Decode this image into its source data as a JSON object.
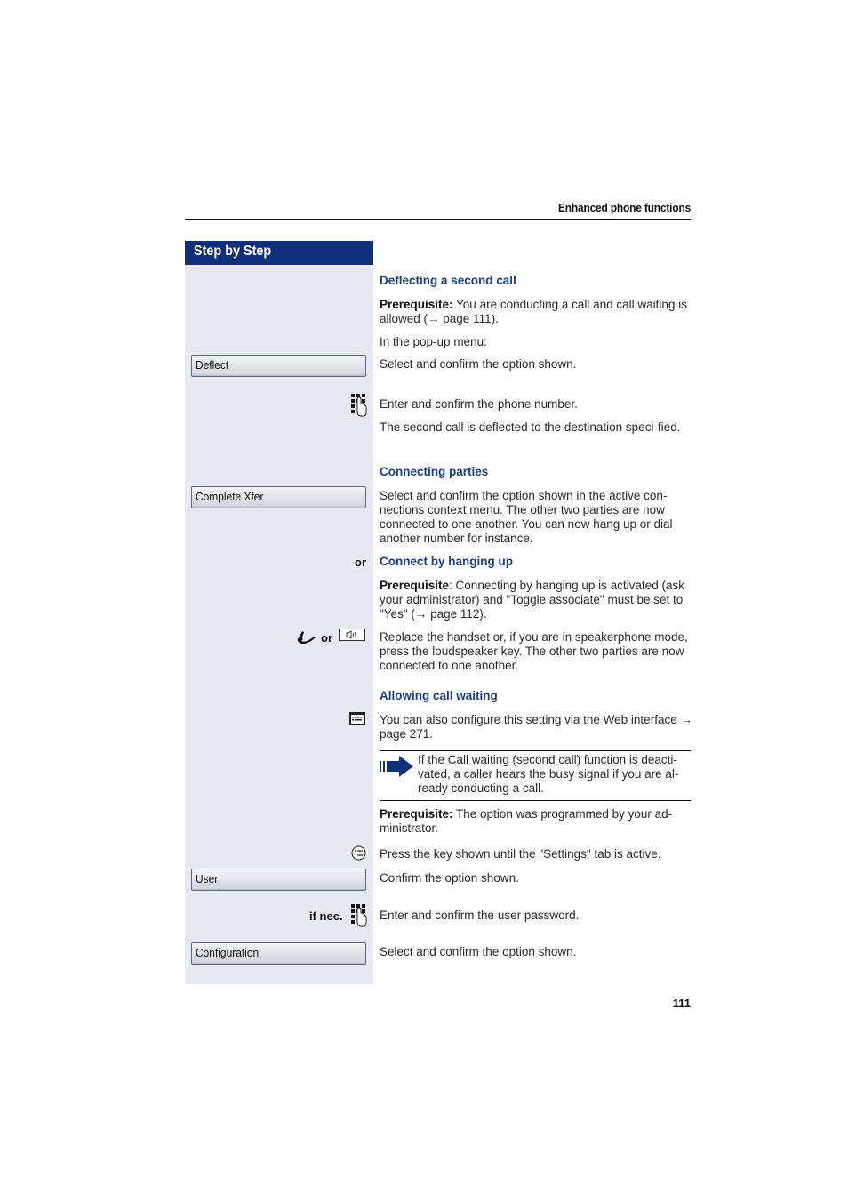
{
  "header": {
    "section_title": "Enhanced phone functions"
  },
  "sidebar": {
    "title": "Step by Step"
  },
  "sections": {
    "deflect": {
      "heading": "Deflecting a second call",
      "prereq_label": "Prerequisite:",
      "prereq_text": " You are conducting a call and call waiting is allowed (→ page 111).",
      "popup_text": "In the pop-up menu:",
      "softkey": "Deflect",
      "softkey_text": "Select and confirm the option shown.",
      "keypad_text": "Enter and confirm the phone number.",
      "result_text": "The second call is deflected to the destination speci-fied."
    },
    "connecting": {
      "heading": "Connecting parties",
      "softkey": "Complete Xfer",
      "softkey_text": "Select and confirm the option shown in the active con-nections context menu. The other two parties are now connected to one another. You can now hang up or dial another number for instance.",
      "or_label": "or"
    },
    "hangup": {
      "heading": "Connect by hanging up",
      "prereq_label": "Prerequisite",
      "prereq_text": ": Connecting by hanging up is activated (ask your administrator) and \"Toggle associate\" must be set to \"Yes\" (→ page 112).",
      "or_label": "or",
      "action_text": "Replace the handset or, if you are in speakerphone mode, press the loudspeaker key. The other two parties are now connected to one another."
    },
    "waiting": {
      "heading": "Allowing call waiting",
      "web_text": "You can also configure this setting via the Web interface → page 271.",
      "note_text": "If the Call waiting (second call) function is deacti-vated, a caller hears the busy signal if you are al-ready conducting a call.",
      "prereq_label": "Prerequisite:",
      "prereq_text": " The option was programmed by your ad-ministrator.",
      "menu_key_text": "Press the key shown until the \"Settings\" tab is active.",
      "softkey_user": "User",
      "user_text": "Confirm the option shown.",
      "if_nec_label": "if nec.",
      "password_text": "Enter and confirm the user password.",
      "softkey_config": "Configuration",
      "config_text": "Select and confirm the option shown."
    }
  },
  "footer": {
    "page_number": "111"
  },
  "colors": {
    "sidebar_header": "#12307a",
    "sidebar_bg": "#e6e8f2",
    "heading": "#1d3c8a"
  }
}
